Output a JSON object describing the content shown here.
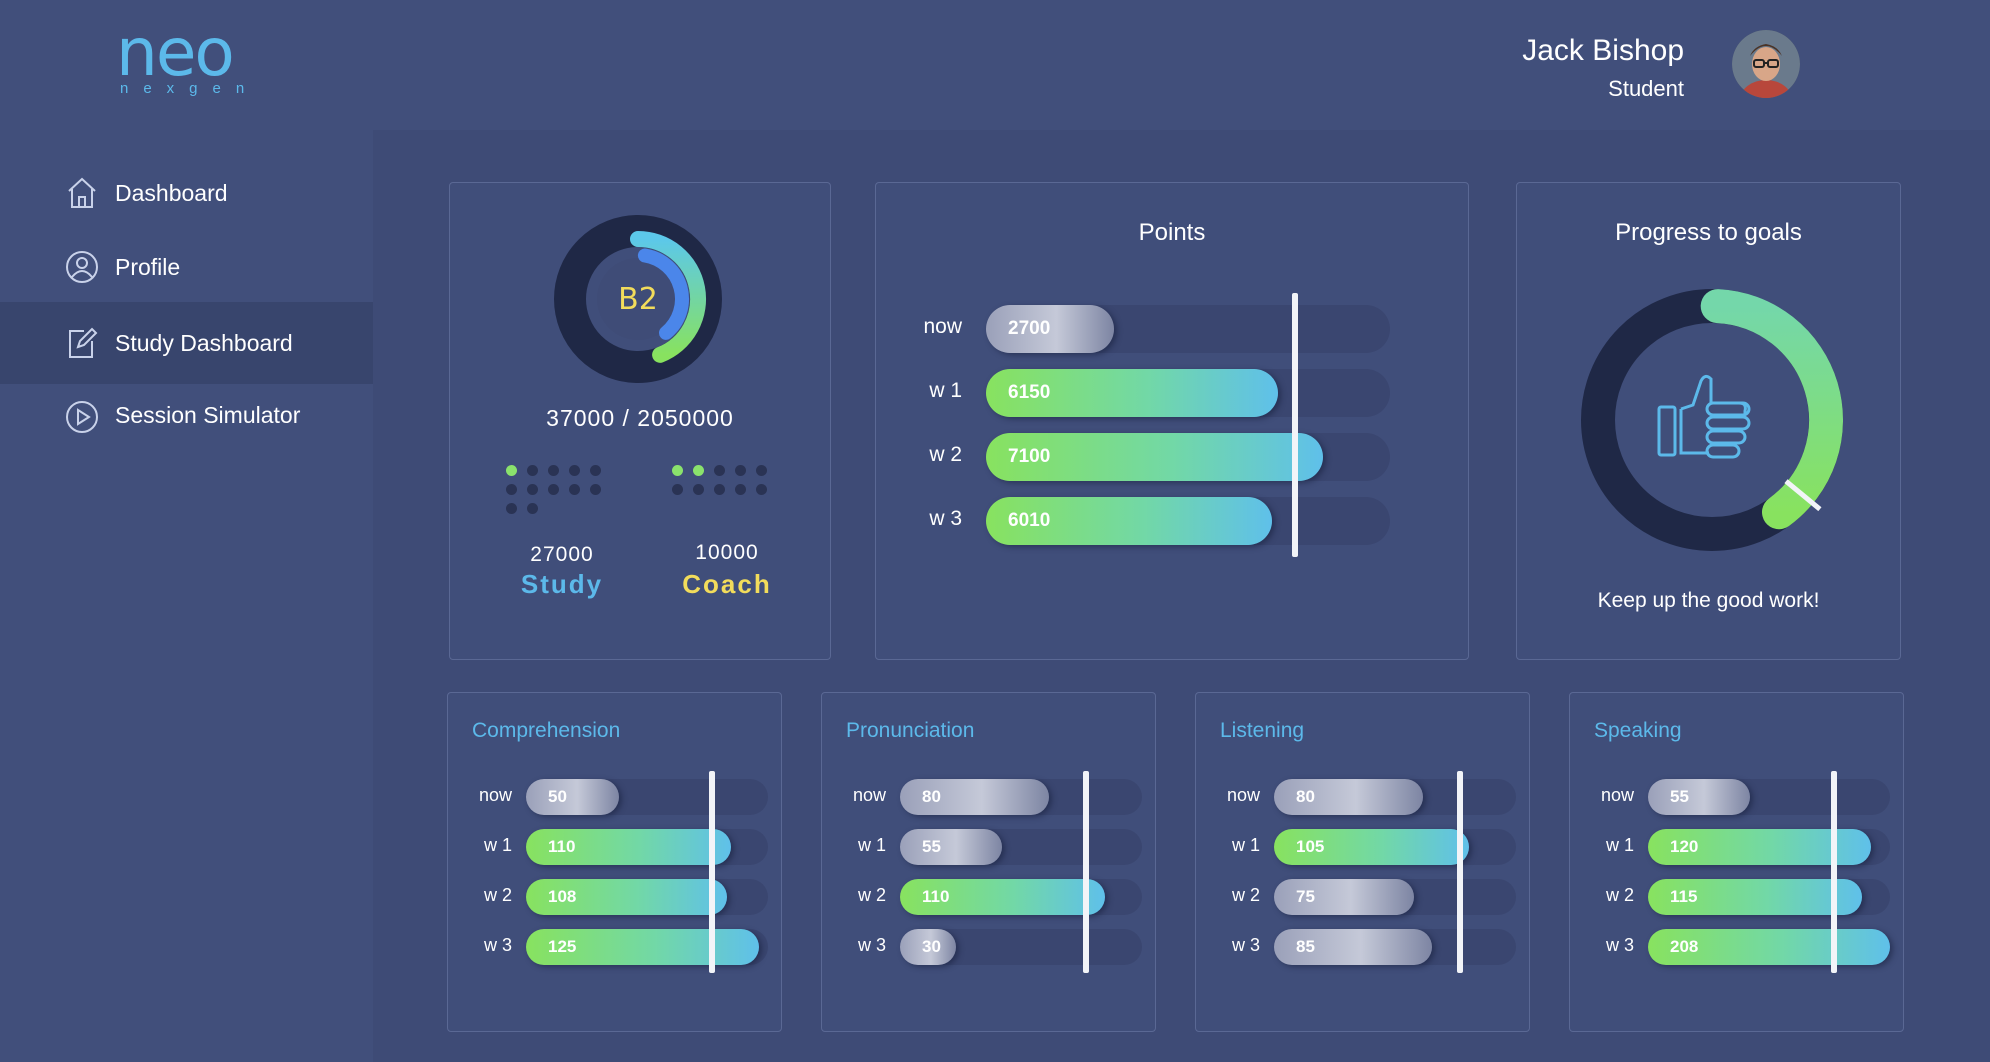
{
  "brand": {
    "name": "neo",
    "sub": "nexgen"
  },
  "user": {
    "name": "Jack Bishop",
    "role": "Student"
  },
  "nav": [
    {
      "label": "Dashboard",
      "icon": "home-icon",
      "active": false
    },
    {
      "label": "Profile",
      "icon": "user-icon",
      "active": false
    },
    {
      "label": "Study Dashboard",
      "icon": "edit-icon",
      "active": true
    },
    {
      "label": "Session Simulator",
      "icon": "play-icon",
      "active": false
    }
  ],
  "level": {
    "badge": "B2",
    "progress_text": "37000 / 2050000",
    "study": {
      "value": "27000",
      "label": "Study",
      "dots_on": 1,
      "dots_total": 12,
      "color": "#5cb9ea"
    },
    "coach": {
      "value": "10000",
      "label": "Coach",
      "dots_on": 2,
      "dots_total": 10,
      "color": "#f2dc5b"
    }
  },
  "points": {
    "title": "Points",
    "max": 8500,
    "marker": 6500,
    "rows": [
      {
        "label": "now",
        "value": 2700,
        "style": "grey"
      },
      {
        "label": "w 1",
        "value": 6150,
        "style": "green"
      },
      {
        "label": "w 2",
        "value": 7100,
        "style": "green"
      },
      {
        "label": "w 3",
        "value": 6010,
        "style": "green"
      }
    ]
  },
  "goals": {
    "title": "Progress to goals",
    "message": "Keep up the good work!",
    "progress_fraction": 0.4,
    "marker_fraction": 0.36
  },
  "skills": [
    {
      "title": "Comprehension",
      "max": 130,
      "marker": 100,
      "rows": [
        {
          "label": "now",
          "value": 50,
          "style": "grey"
        },
        {
          "label": "w 1",
          "value": 110,
          "style": "green"
        },
        {
          "label": "w 2",
          "value": 108,
          "style": "green"
        },
        {
          "label": "w 3",
          "value": 125,
          "style": "green"
        }
      ]
    },
    {
      "title": "Pronunciation",
      "max": 130,
      "marker": 100,
      "rows": [
        {
          "label": "now",
          "value": 80,
          "style": "grey"
        },
        {
          "label": "w 1",
          "value": 55,
          "style": "grey"
        },
        {
          "label": "w 2",
          "value": 110,
          "style": "green"
        },
        {
          "label": "w 3",
          "value": 30,
          "style": "grey"
        }
      ]
    },
    {
      "title": "Listening",
      "max": 130,
      "marker": 100,
      "rows": [
        {
          "label": "now",
          "value": 80,
          "style": "grey"
        },
        {
          "label": "w 1",
          "value": 105,
          "style": "green"
        },
        {
          "label": "w 2",
          "value": 75,
          "style": "grey"
        },
        {
          "label": "w 3",
          "value": 85,
          "style": "grey"
        }
      ]
    },
    {
      "title": "Speaking",
      "max": 130,
      "marker": 100,
      "rows": [
        {
          "label": "now",
          "value": 55,
          "style": "grey"
        },
        {
          "label": "w 1",
          "value": 120,
          "style": "green"
        },
        {
          "label": "w 2",
          "value": 115,
          "style": "green"
        },
        {
          "label": "w 3",
          "value": 208,
          "style": "green"
        }
      ]
    }
  ],
  "colors": {
    "accent": "#5cb9ea",
    "green": "#88e25f",
    "yellow": "#f2dc5b",
    "dark": "#1e2745"
  }
}
